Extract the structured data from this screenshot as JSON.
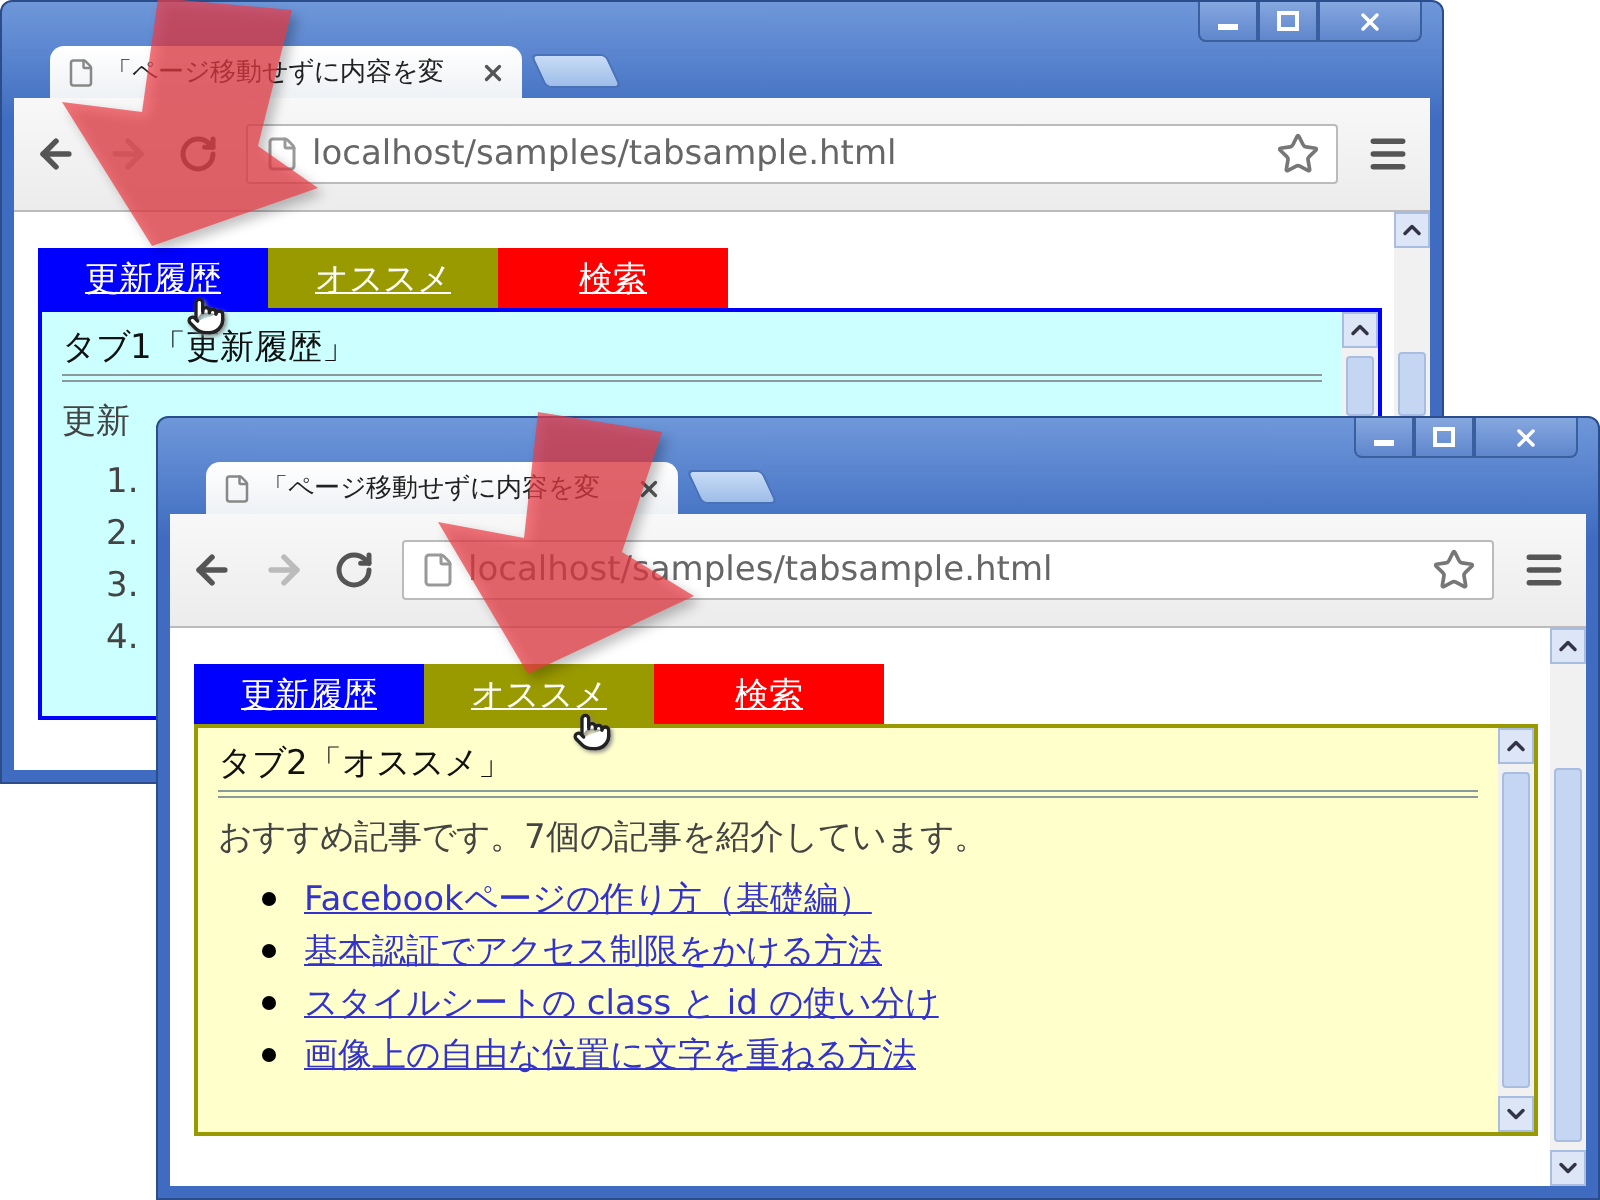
{
  "windows": [
    {
      "tab_title": "「ページ移動せずに内容を変",
      "url": "localhost/samples/tabsample.html",
      "page_tabs": [
        {
          "label": "更新履歴",
          "color": "#0000ff",
          "selected": true
        },
        {
          "label": "オススメ",
          "color": "#999900",
          "selected": false
        },
        {
          "label": "検索",
          "color": "#ff0000",
          "selected": false
        }
      ],
      "panel": {
        "heading": "タブ1「更新履歴」",
        "intro": "更新",
        "items": [
          {
            "marker": "1."
          },
          {
            "marker": "2."
          },
          {
            "marker": "3."
          },
          {
            "marker": "4."
          }
        ]
      }
    },
    {
      "tab_title": "「ページ移動せずに内容を変",
      "url": "localhost/samples/tabsample.html",
      "page_tabs": [
        {
          "label": "更新履歴",
          "color": "#0000ff",
          "selected": false
        },
        {
          "label": "オススメ",
          "color": "#999900",
          "selected": true
        },
        {
          "label": "検索",
          "color": "#ff0000",
          "selected": false
        }
      ],
      "panel": {
        "heading": "タブ2「オススメ」",
        "intro": "おすすめ記事です。7個の記事を紹介しています。",
        "items": [
          {
            "text": "Facebookページの作り方（基礎編）"
          },
          {
            "text": "基本認証でアクセス制限をかける方法"
          },
          {
            "text": "スタイルシートの class と id の使い分け"
          },
          {
            "text": "画像上の自由な位置に文字を重ねる方法"
          }
        ]
      }
    }
  ]
}
